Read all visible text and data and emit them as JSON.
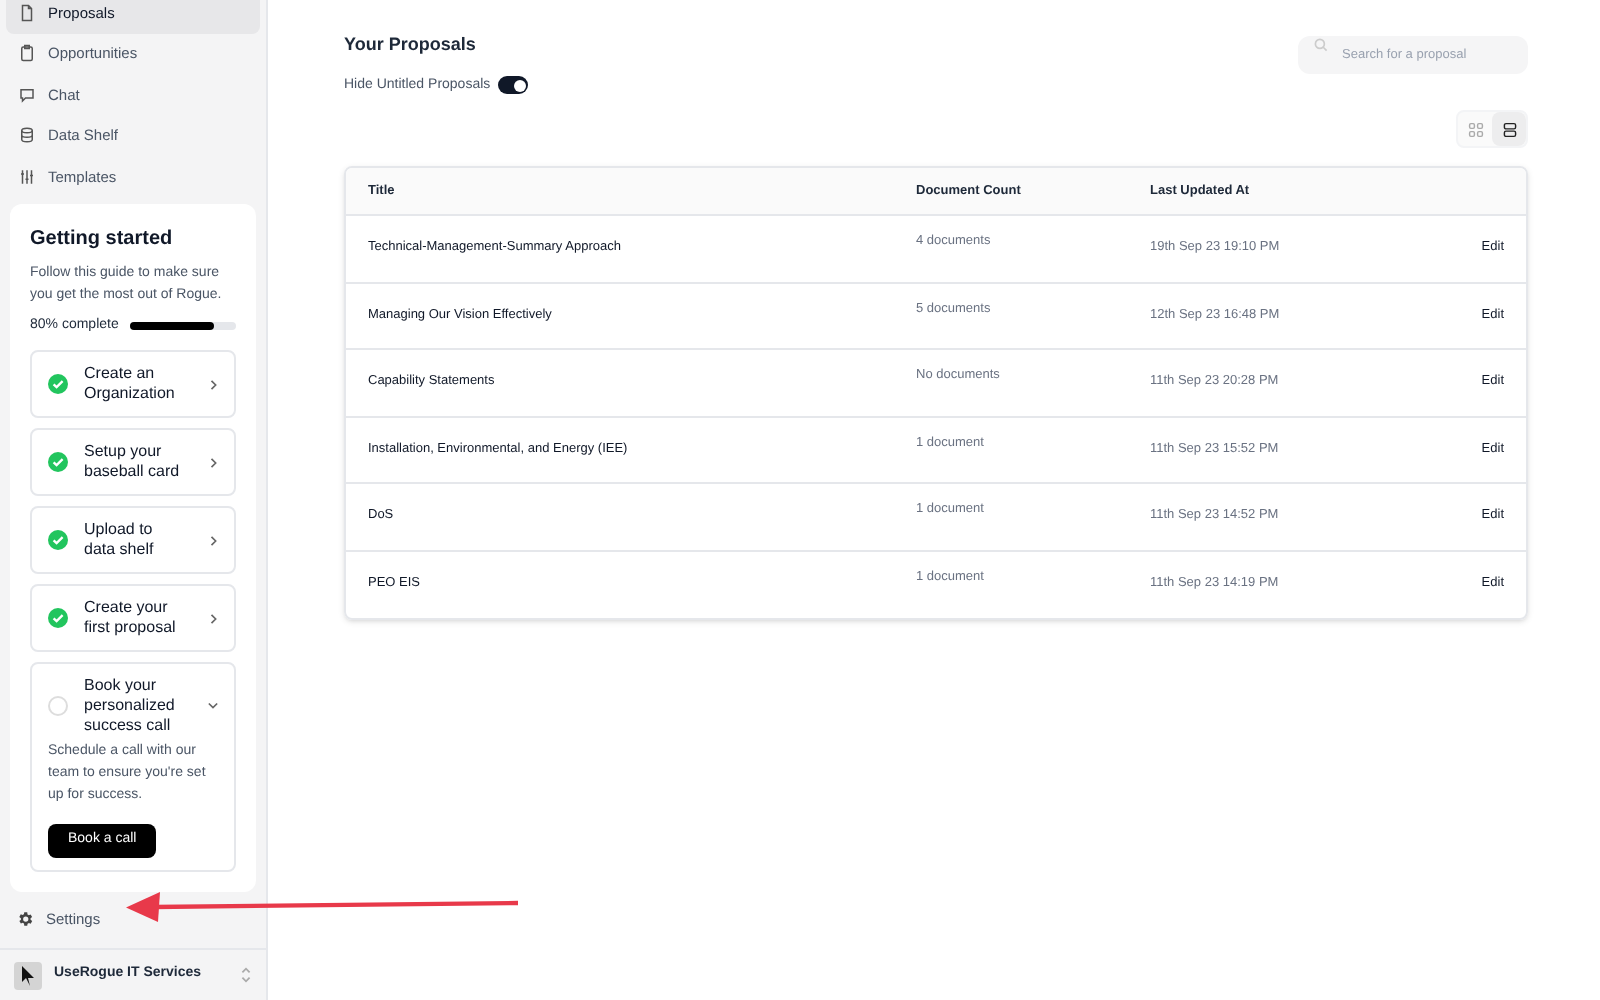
{
  "sidebar": {
    "nav": [
      {
        "label": "Proposals",
        "selected": true
      },
      {
        "label": "Opportunities",
        "selected": false
      },
      {
        "label": "Chat",
        "selected": false
      },
      {
        "label": "Data Shelf",
        "selected": false
      },
      {
        "label": "Templates",
        "selected": false
      }
    ],
    "getting_started": {
      "title": "Getting started",
      "description": "Follow this guide to make sure you get the most out of Rogue.",
      "progress_label": "80% complete",
      "level": 0.8,
      "steps": [
        {
          "label": "Create an Organization",
          "done": true,
          "expanded": false
        },
        {
          "label": "Setup your baseball card",
          "done": true,
          "expanded": false
        },
        {
          "label": "Upload to data shelf",
          "done": true,
          "expanded": false
        },
        {
          "label": "Create your first proposal",
          "done": true,
          "expanded": false
        },
        {
          "label": "Book your personalized success call",
          "done": false,
          "expanded": true,
          "detail": "Schedule a call with our team to ensure you're set up for success.",
          "button": "Book a call"
        }
      ]
    },
    "settings": "Settings",
    "organization": "UseRogue IT Services"
  },
  "main": {
    "title": "Your Proposals",
    "hide_untitled": {
      "label": "Hide Untitled Proposals",
      "on": true
    },
    "search": {
      "placeholder": "Search for a proposal"
    },
    "view_toggle": [
      {
        "kind": "grid",
        "selected": false
      },
      {
        "kind": "list",
        "selected": true
      }
    ],
    "table": {
      "columns": [
        "Title",
        "Document Count",
        "Last Updated At"
      ],
      "rows": [
        {
          "title": "Technical-Management-Summary Approach",
          "count": "4 documents",
          "updated": "19th Sep 23 19:10 PM",
          "action": "Edit"
        },
        {
          "title": "Managing Our Vision Effectively",
          "count": "5 documents",
          "updated": "12th Sep 23 16:48 PM",
          "action": "Edit"
        },
        {
          "title": "Capability Statements",
          "count": "No documents",
          "updated": "11th Sep 23 20:28 PM",
          "action": "Edit"
        },
        {
          "title": "Installation, Environmental, and Energy (IEE)",
          "count": "1 document",
          "updated": "11th Sep 23 15:52 PM",
          "action": "Edit"
        },
        {
          "title": "DoS",
          "count": "1 document",
          "updated": "11th Sep 23 14:52 PM",
          "action": "Edit"
        },
        {
          "title": "PEO EIS",
          "count": "1 document",
          "updated": "11th Sep 23 14:19 PM",
          "action": "Edit"
        }
      ]
    }
  },
  "annotation": {
    "kind": "arrow"
  }
}
